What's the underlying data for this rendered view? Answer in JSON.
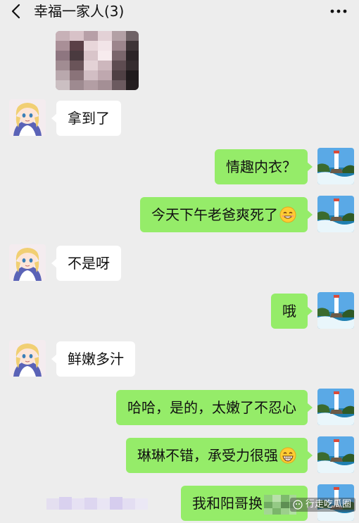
{
  "header": {
    "title": "幸福一家人(3)",
    "back_icon": "chevron-left-icon",
    "more_icon": "more-dots-icon"
  },
  "messages": [
    {
      "side": "in",
      "kind": "image",
      "content": "pixelated photo"
    },
    {
      "side": "in",
      "kind": "text",
      "text": "拿到了"
    },
    {
      "side": "out",
      "kind": "text",
      "text": "情趣内衣？"
    },
    {
      "side": "out",
      "kind": "text",
      "text": "今天下午老爸爽死了",
      "emoji": "smiling-emoji"
    },
    {
      "side": "in",
      "kind": "text",
      "text": "不是呀"
    },
    {
      "side": "out",
      "kind": "text",
      "text": "哦"
    },
    {
      "side": "in",
      "kind": "text",
      "text": "鲜嫩多汁"
    },
    {
      "side": "out",
      "kind": "text",
      "text": "哈哈，是的，太嫩了不忍心"
    },
    {
      "side": "out",
      "kind": "text",
      "text": "琳琳不错，承受力很强",
      "emoji": "grinning-emoji"
    },
    {
      "side": "out",
      "kind": "text",
      "text": "我和阳哥换"
    }
  ],
  "watermark": {
    "text": "行走吃瓜圈"
  },
  "colors": {
    "background": "#ededed",
    "outgoing_bubble": "#95ec69",
    "incoming_bubble": "#ffffff",
    "text": "#111111"
  }
}
